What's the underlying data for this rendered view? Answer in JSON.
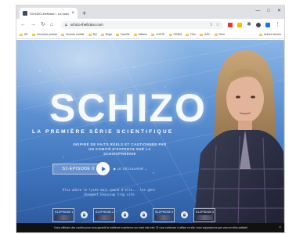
{
  "browser": {
    "tab_title": "SCHIZO-thefiction - La nouvelle ...",
    "tab_close": "×",
    "new_tab": "+",
    "window_controls": [
      "—",
      "□",
      "✕"
    ],
    "url": "schizo-thefiction.com",
    "nav": {
      "back": "←",
      "forward": "→",
      "reload": "↻",
      "home": "⌂"
    },
    "bookmarks": [
      "AP",
      "Journaux presse",
      "Bureau mobile",
      "BQ",
      "Bugs",
      "Famille",
      "Maison",
      "JUSTE",
      "OBDM",
      "Film",
      "AAC",
      "Rem"
    ],
    "bookmarks_right": "Autres favoris",
    "extension_colors": [
      "#e53935",
      "#fbbc04",
      "#444444",
      "#1a73e8",
      "#5f6368"
    ]
  },
  "hero": {
    "logo": "SCHIZO",
    "subtitle": "LA PREMIÈRE SÉRIE SCIENTIFIQUE",
    "tagline": "INSPIRÉ DE FAITS RÉELS ET CAUTIONNÉE PAR UN COMITÉ D'EXPERTS SUR LA SCHIZOPHRÉNIE",
    "episode_button": "S1-EPISODE 0",
    "discover": "▶ LE DÉCOUVRIR →",
    "quote": "Elsa adore le lycée mais quand d'elle... les gens changent beaucoup trop vite"
  },
  "episodes": [
    {
      "label": "S1-EPISODE 1"
    },
    {
      "label": "S1-EPISODE 2"
    },
    {
      "label": "S1-EPISODE 3"
    },
    {
      "label": "S1-EPISODE 4"
    }
  ],
  "cookie": {
    "text": "Nous utilisons des cookies pour vous garantir la meilleure expérience sur notre site web. Si vous continuez à utiliser ce site, nous supposerons que vous en êtes satisfait.",
    "close": "×"
  },
  "colors": {
    "sky_top": "#8bb6e6",
    "sky_bottom": "#2a569a",
    "cookie_bar": "#111111"
  }
}
